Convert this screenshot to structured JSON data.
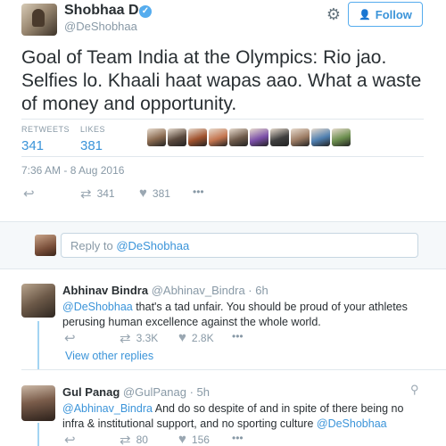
{
  "tweet": {
    "author_name": "Shobhaa De",
    "author_handle": "@DeShobhaa",
    "verified_glyph": "✓",
    "follow_label": "Follow",
    "text": "Goal of Team India at the Olympics: Rio jao. Selfies lo. Khaali haat wapas aao. What a waste of money and opportunity.",
    "retweets_label": "RETWEETS",
    "retweets_count": "341",
    "likes_label": "LIKES",
    "likes_count": "381",
    "timestamp": "7:36 AM - 8 Aug 2016",
    "action_retweet_count": "341",
    "action_like_count": "381",
    "more_glyph": "•••",
    "liker_colors": [
      "#8a6a50",
      "#5b4a3e",
      "#a0522d",
      "#c4754f",
      "#6e5a4a",
      "#7b4fa8",
      "#3f3f3f",
      "#9b7b63",
      "#4f7fb0",
      "#6b8e4e"
    ]
  },
  "reply_box": {
    "prefix": "Reply to ",
    "mention": "@DeShobhaa"
  },
  "replies": [
    {
      "name": "Abhinav Bindra",
      "handle": "@Abhinav_Bindra",
      "age": "6h",
      "mention": "@DeShobhaa",
      "text": " that's a tad unfair.  You should be proud of your athletes perusing human excellence against the whole world.",
      "retweet_count": "3.3K",
      "like_count": "2.8K",
      "view_more": "View other replies"
    },
    {
      "name": "Gul Panag",
      "handle": "@GulPanag",
      "age": "5h",
      "mention": "@Abhinav_Bindra",
      "text_mid": "  And do so despite of and in spite of there being no infra & institutional support, and no sporting culture ",
      "mention_end": "@DeShobhaa",
      "retweet_count": "80",
      "like_count": "156"
    }
  ],
  "icons": {
    "gear": "gear-icon",
    "add_user": "add-user-icon",
    "reply": "reply-icon",
    "retweet": "retweet-icon",
    "like": "heart-icon",
    "more": "more-icon",
    "location": "location-pin-icon"
  }
}
